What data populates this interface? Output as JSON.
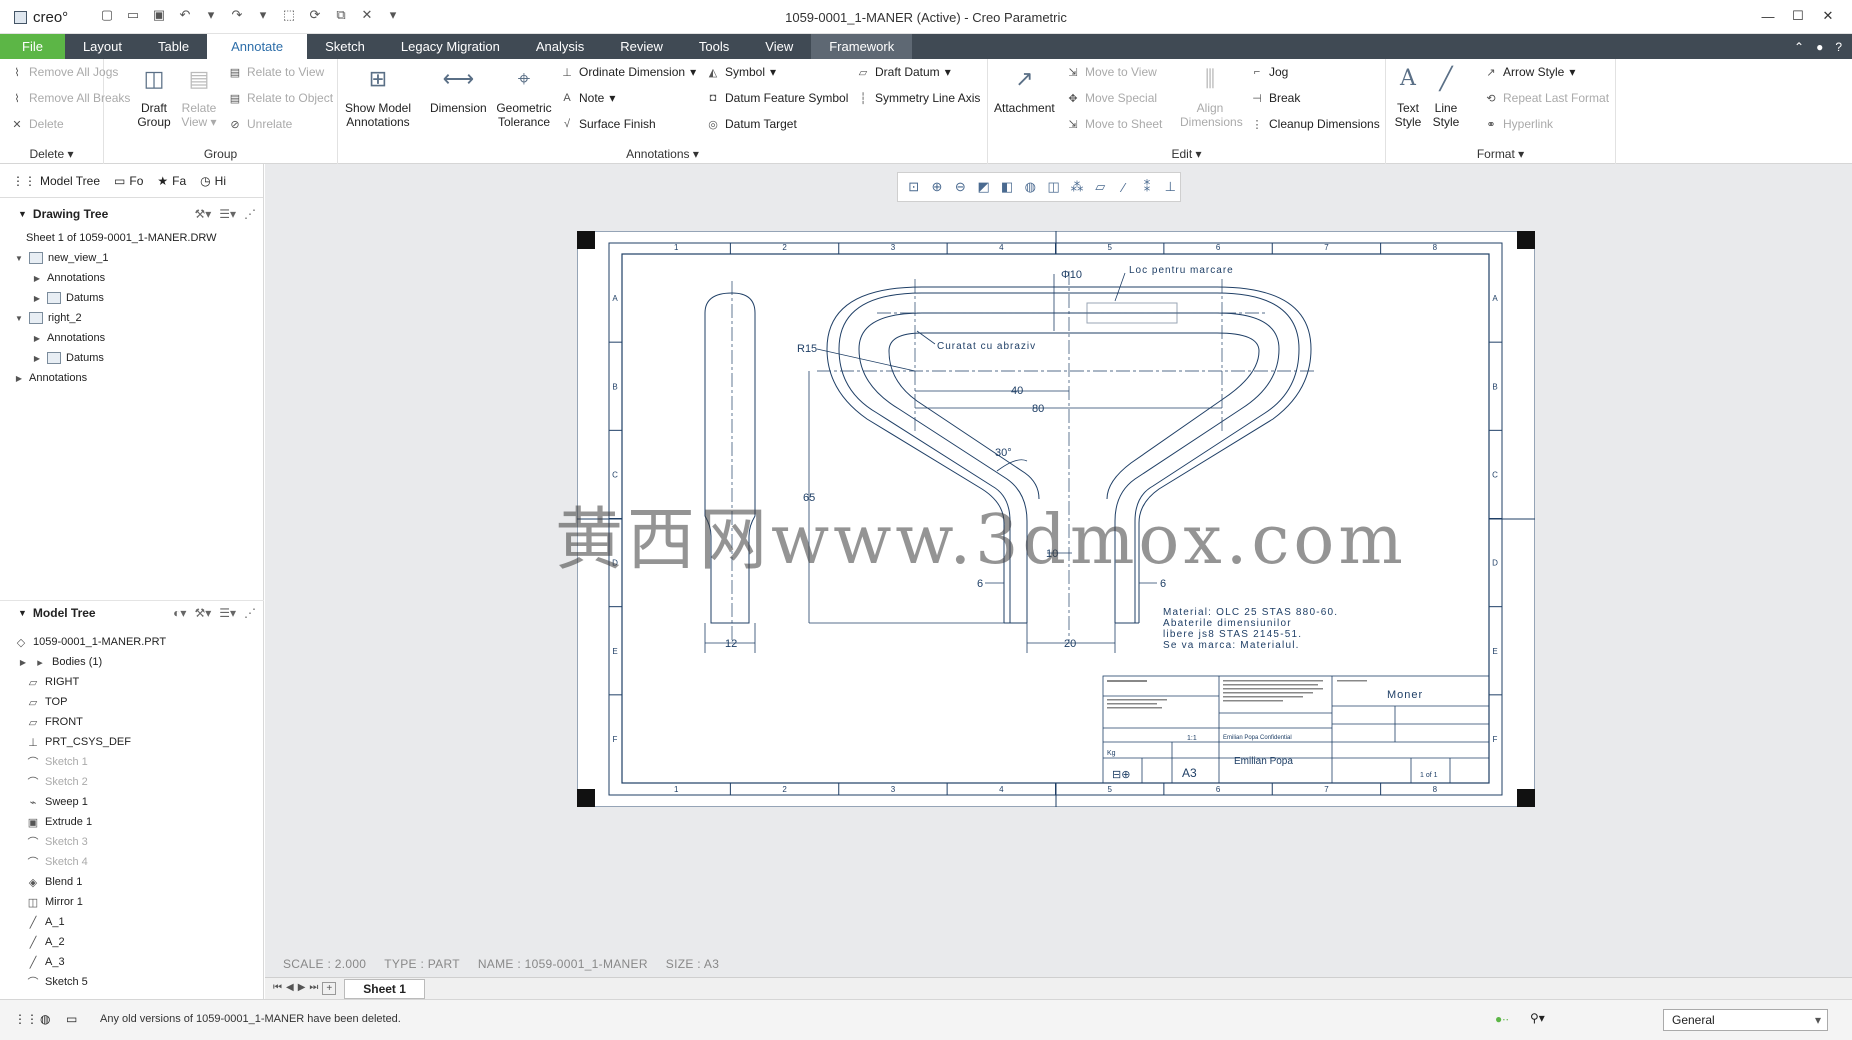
{
  "app": {
    "logo": "creo°",
    "window_title": "1059-0001_1-MANER (Active) - Creo Parametric"
  },
  "tabs": [
    {
      "label": "File"
    },
    {
      "label": "Layout"
    },
    {
      "label": "Table"
    },
    {
      "label": "Annotate"
    },
    {
      "label": "Sketch"
    },
    {
      "label": "Legacy Migration"
    },
    {
      "label": "Analysis"
    },
    {
      "label": "Review"
    },
    {
      "label": "Tools"
    },
    {
      "label": "View"
    },
    {
      "label": "Framework"
    }
  ],
  "ribbon": {
    "delete": {
      "remove_jogs": "Remove All Jogs",
      "remove_breaks": "Remove All Breaks",
      "delete": "Delete",
      "label": "Delete ▾"
    },
    "group": {
      "draft_group": "Draft Group",
      "relate_view": "Relate View ▾",
      "relate_to_view": "Relate to View",
      "relate_to_object": "Relate to Object",
      "unrelate": "Unrelate",
      "label": "Group"
    },
    "annotations": {
      "show_model": "Show Model Annotations",
      "dimension": "Dimension",
      "geometric_tolerance": "Geometric Tolerance",
      "ordinate_dimension": "Ordinate Dimension",
      "note": "Note",
      "surface_finish": "Surface Finish",
      "symbol": "Symbol",
      "datum_feature_symbol": "Datum Feature Symbol",
      "datum_target": "Datum Target",
      "draft_datum": "Draft Datum",
      "symmetry_line_axis": "Symmetry Line Axis",
      "label": "Annotations ▾"
    },
    "edit": {
      "attachment": "Attachment",
      "move_to_view": "Move to View",
      "move_special": "Move Special",
      "move_to_sheet": "Move to Sheet",
      "align_dimensions": "Align Dimensions",
      "jog": "Jog",
      "break": "Break",
      "cleanup_dimensions": "Cleanup Dimensions",
      "label": "Edit ▾"
    },
    "format": {
      "text_style": "Text Style",
      "line_style": "Line Style",
      "arrow_style": "Arrow Style",
      "repeat_last_format": "Repeat Last Format",
      "hyperlink": "Hyperlink",
      "label": "Format ▾"
    }
  },
  "panel_tabs": [
    "Model Tree",
    "Fo",
    "Fa",
    "Hi"
  ],
  "drawing_tree": {
    "title": "Drawing Tree",
    "items": [
      {
        "label": "Sheet 1 of 1059-0001_1-MANER.DRW"
      },
      {
        "label": "new_view_1"
      },
      {
        "label": "Annotations"
      },
      {
        "label": "Datums"
      },
      {
        "label": "right_2"
      },
      {
        "label": "Annotations"
      },
      {
        "label": "Datums"
      },
      {
        "label": "Annotations"
      }
    ]
  },
  "model_tree": {
    "title": "Model Tree",
    "items": [
      {
        "label": "1059-0001_1-MANER.PRT",
        "disabled": false
      },
      {
        "label": "Bodies (1)",
        "disabled": false
      },
      {
        "label": "RIGHT",
        "disabled": false
      },
      {
        "label": "TOP",
        "disabled": false
      },
      {
        "label": "FRONT",
        "disabled": false
      },
      {
        "label": "PRT_CSYS_DEF",
        "disabled": false
      },
      {
        "label": "Sketch 1",
        "disabled": true
      },
      {
        "label": "Sketch 2",
        "disabled": true
      },
      {
        "label": "Sweep 1",
        "disabled": false
      },
      {
        "label": "Extrude 1",
        "disabled": false
      },
      {
        "label": "Sketch 3",
        "disabled": true
      },
      {
        "label": "Sketch 4",
        "disabled": true
      },
      {
        "label": "Blend 1",
        "disabled": false
      },
      {
        "label": "Mirror 1",
        "disabled": false
      },
      {
        "label": "A_1",
        "disabled": false
      },
      {
        "label": "A_2",
        "disabled": false
      },
      {
        "label": "A_3",
        "disabled": false
      },
      {
        "label": "Sketch 5",
        "disabled": false
      }
    ]
  },
  "drawing": {
    "zone_numbers": [
      "1",
      "2",
      "3",
      "4",
      "5",
      "6",
      "7",
      "8"
    ],
    "zone_letters": [
      "A",
      "B",
      "C",
      "D",
      "E",
      "F"
    ],
    "dims": {
      "d_phi": "Φ10",
      "d_r15": "R15",
      "d_40": "40",
      "d_80": "80",
      "d_30": "30°",
      "d_65": "65",
      "d_10": "10",
      "d_6a": "6",
      "d_6b": "6",
      "d_20": "20",
      "d_12": "12"
    },
    "notes": {
      "marking": "Loc pentru marcare",
      "abrasive": "Curatat cu abraziv",
      "mat1": "Material: OLC 25 STAS 880-60.",
      "mat2": "Abaterile dimensiunilor",
      "mat3": "libere js8 STAS 2145-51.",
      "mat4": "Se va marca: Materialul."
    },
    "title_block": {
      "title": "Moner",
      "size": "A3",
      "author": "Emilian Popa",
      "confidential": "Emilian Popa Confidential",
      "sheet": "1 of 1",
      "scale": "1:1",
      "mass": "Kg"
    }
  },
  "canvas_info": {
    "scale": "SCALE : 2.000",
    "type": "TYPE : PART",
    "name": "NAME : 1059-0001_1-MANER",
    "size": "SIZE : A3"
  },
  "watermark": "黄西网www.3dmox.com",
  "sheet_tab": "Sheet 1",
  "status": {
    "message": "Any old versions of 1059-0001_1-MANER have been deleted.",
    "filter": "General"
  },
  "colors": {
    "accent": "#2d6ea9",
    "file_tab": "#5cb646",
    "tabbar": "#404a54",
    "drawing_line": "#1f3f66"
  }
}
